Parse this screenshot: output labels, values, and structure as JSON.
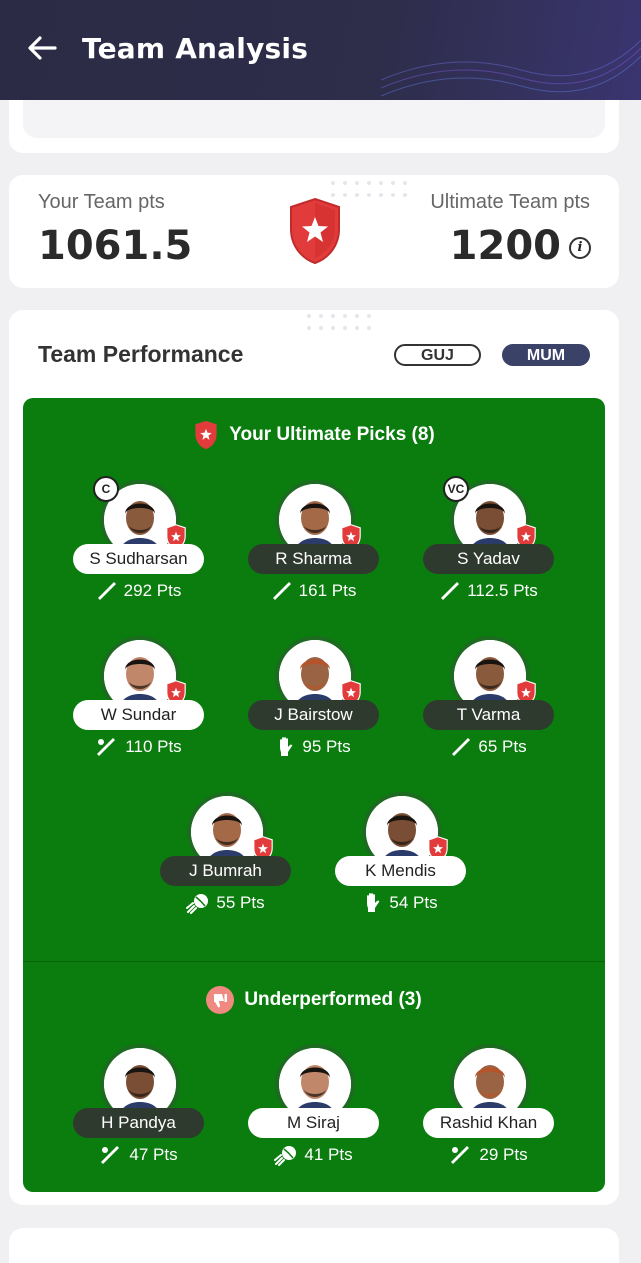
{
  "header": {
    "title": "Team Analysis"
  },
  "points": {
    "your_label": "Your Team pts",
    "your_value": "1061.5",
    "ultimate_label": "Ultimate Team pts",
    "ultimate_value": "1200"
  },
  "performance": {
    "title": "Team Performance",
    "teams": [
      "GUJ",
      "MUM"
    ],
    "selected_team": "MUM",
    "picks_heading": "Your Ultimate Picks (8)",
    "under_heading": "Underperformed (3)",
    "picks": [
      {
        "name": "S Sudharsan",
        "pts": "292 Pts",
        "role": "C",
        "style": "light",
        "icon": "bat-icon"
      },
      {
        "name": "R Sharma",
        "pts": "161 Pts",
        "role": "",
        "style": "dark",
        "icon": "bat-icon"
      },
      {
        "name": "S Yadav",
        "pts": "112.5 Pts",
        "role": "VC",
        "style": "dark",
        "icon": "bat-icon"
      },
      {
        "name": "W Sundar",
        "pts": "110 Pts",
        "role": "",
        "style": "light",
        "icon": "allrounder-icon"
      },
      {
        "name": "J Bairstow",
        "pts": "95 Pts",
        "role": "",
        "style": "dark",
        "icon": "glove-icon"
      },
      {
        "name": "T Varma",
        "pts": "65 Pts",
        "role": "",
        "style": "dark",
        "icon": "bat-icon"
      },
      {
        "name": "J Bumrah",
        "pts": "55 Pts",
        "role": "",
        "style": "dark",
        "icon": "ball-icon"
      },
      {
        "name": "K Mendis",
        "pts": "54 Pts",
        "role": "",
        "style": "light",
        "icon": "glove-icon"
      }
    ],
    "under": [
      {
        "name": "H Pandya",
        "pts": "47 Pts",
        "style": "dark",
        "icon": "allrounder-icon"
      },
      {
        "name": "M Siraj",
        "pts": "41 Pts",
        "style": "light",
        "icon": "ball-icon"
      },
      {
        "name": "Rashid Khan",
        "pts": "29 Pts",
        "style": "light",
        "icon": "allrounder-icon"
      }
    ]
  },
  "colors": {
    "header": "#2b2b45",
    "panel_green": "#0a7d0e",
    "shield_red": "#e23b3b",
    "pill_dark": "#3a4268"
  }
}
